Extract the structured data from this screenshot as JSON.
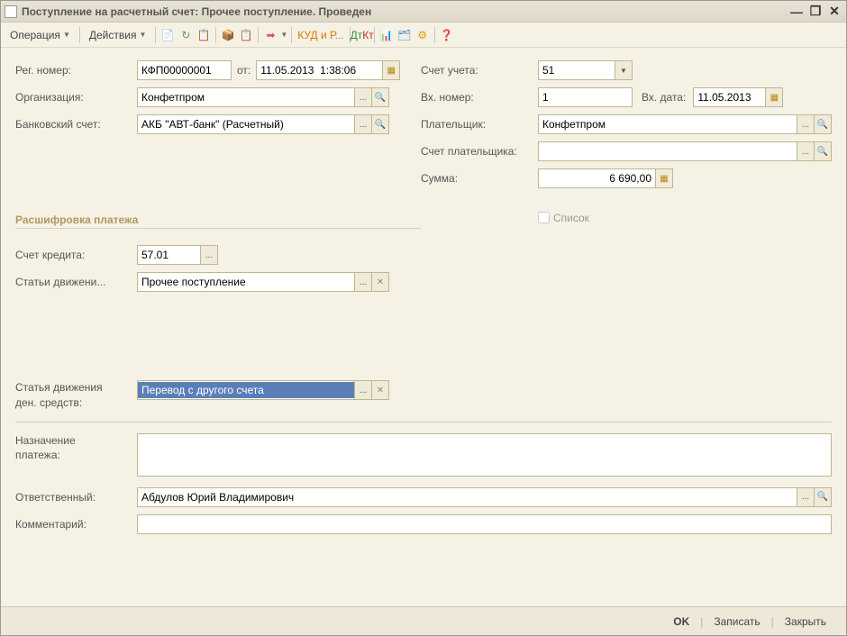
{
  "window": {
    "title": "Поступление на расчетный счет: Прочее поступление. Проведен"
  },
  "menu": {
    "operation": "Операция",
    "actions": "Действия",
    "kudr": "КУД и Р..."
  },
  "labels": {
    "reg_number": "Рег. номер:",
    "from": "от:",
    "organization": "Организация:",
    "bank_account": "Банковский счет:",
    "account": "Счет учета:",
    "in_number": "Вх. номер:",
    "in_date": "Вх. дата:",
    "payer": "Плательщик:",
    "payer_account": "Счет плательщика:",
    "sum": "Сумма:",
    "list": "Список",
    "section": "Расшифровка платежа",
    "credit_account": "Счет кредита:",
    "movement_article": "Статьи движени...",
    "cashflow_article1": "Статья движения",
    "cashflow_article2": "ден. средств:",
    "purpose": "Назначение",
    "purpose2": "платежа:",
    "responsible": "Ответственный:",
    "comment": "Комментарий:"
  },
  "values": {
    "reg_number": "КФП00000001",
    "datetime": "11.05.2013  1:38:06",
    "organization": "Конфетпром",
    "bank_account": "АКБ \"АВТ-банк\" (Расчетный)",
    "account": "51",
    "in_number": "1",
    "in_date": "11.05.2013",
    "payer": "Конфетпром",
    "payer_account": "",
    "sum": "6 690,00",
    "credit_account": "57.01",
    "movement_article": "Прочее поступление",
    "cashflow_article": "Перевод с другого счета",
    "purpose": "",
    "responsible": "Абдулов Юрий Владимирович",
    "comment": ""
  },
  "footer": {
    "ok": "OK",
    "save": "Записать",
    "close": "Закрыть"
  }
}
